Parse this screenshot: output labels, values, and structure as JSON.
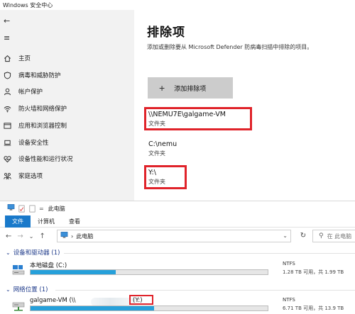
{
  "security_window": {
    "title": "Windows 安全中心",
    "nav_back_glyph": "←",
    "nav_menu_glyph": "≡",
    "sidebar": {
      "items": [
        {
          "icon": "home-icon",
          "label": "主页"
        },
        {
          "icon": "shield-icon",
          "label": "病毒和威胁防护"
        },
        {
          "icon": "person-icon",
          "label": "帐户保护"
        },
        {
          "icon": "wifi-icon",
          "label": "防火墙和网络保护"
        },
        {
          "icon": "app-browser-icon",
          "label": "应用和浏览器控制"
        },
        {
          "icon": "laptop-icon",
          "label": "设备安全性"
        },
        {
          "icon": "heart-icon",
          "label": "设备性能和运行状况"
        },
        {
          "icon": "family-icon",
          "label": "家庭选项"
        }
      ]
    },
    "main": {
      "title": "排除项",
      "description": "添加或删除要从 Microsoft Defender 防病毒扫描中排除的项目。",
      "add_button_label": "添加排除项",
      "add_button_glyph": "+",
      "exclusions": [
        {
          "path": "\\\\NEMU7E\\galgame-VM",
          "type": "文件夹",
          "highlighted": true
        },
        {
          "path": "C:\\nemu",
          "type": "文件夹",
          "highlighted": false
        },
        {
          "path": "Y:\\",
          "type": "文件夹",
          "highlighted": true
        }
      ],
      "highlight_color": "#e0232a"
    }
  },
  "explorer_window": {
    "title": "此电脑",
    "title_separator": "=",
    "ribbon_tabs": [
      "文件",
      "计算机",
      "查看"
    ],
    "nav": {
      "back": "←",
      "forward": "→",
      "recent": "⌄",
      "up": "↑"
    },
    "address": {
      "separator": "›",
      "crumb": "此电脑",
      "dropdown": "⌄"
    },
    "refresh_glyph": "↻",
    "search_placeholder": "在 此电脑",
    "search_glyph": "⚲",
    "groups": [
      {
        "title": "设备和驱动器 (1)",
        "drives": [
          {
            "name": "本地磁盘 (C:)",
            "fs": "NTFS",
            "space": "1.28 TB 可用，共 1.99 TB",
            "used_fraction": 0.36,
            "icon": "local-disk-icon"
          }
        ]
      },
      {
        "title": "网络位置 (1)",
        "drives": [
          {
            "name_prefix": "galgame-VM (\\\\",
            "name_suffix": "(Y:)",
            "fs": "NTFS",
            "space": "6.71 TB 可用，共 13.9 TB",
            "used_fraction": 0.52,
            "icon": "network-drive-icon"
          }
        ]
      }
    ],
    "group_chevron": "⌄",
    "accent_color": "#1979ca",
    "bar_color": "#26a0da"
  }
}
